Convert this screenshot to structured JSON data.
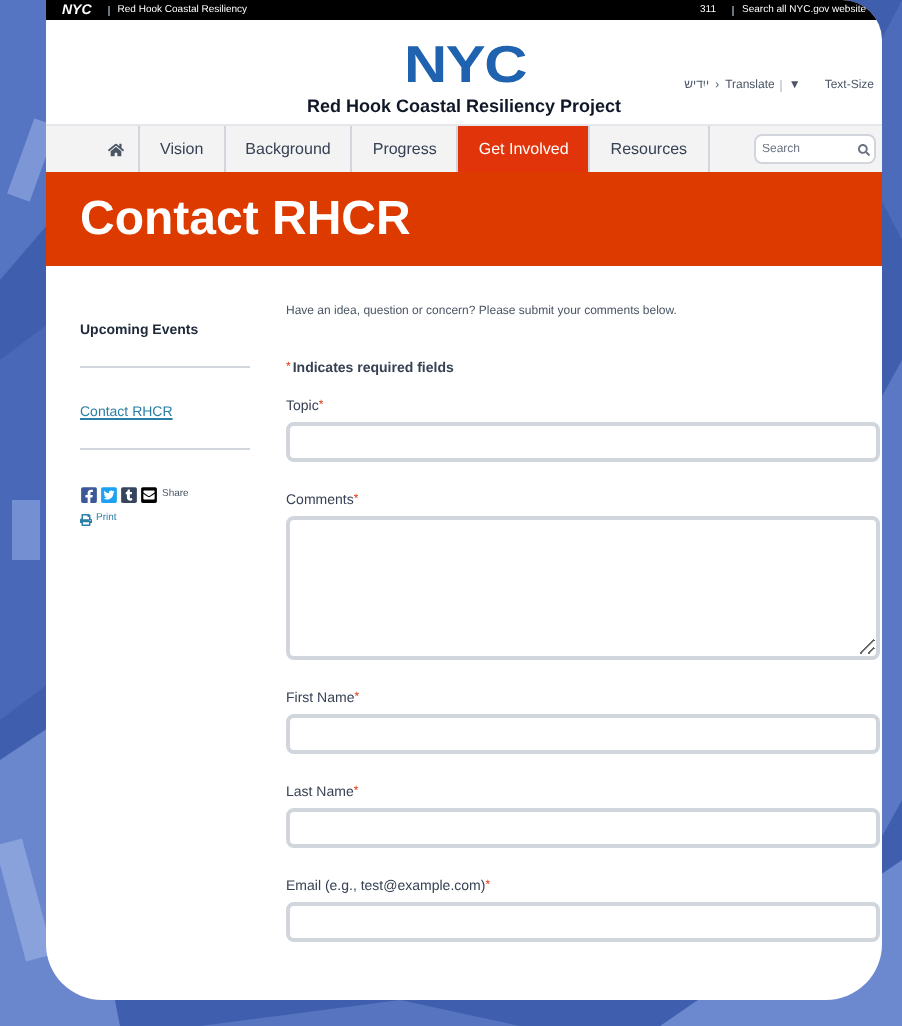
{
  "top_bar": {
    "logo": "NYC",
    "site_name": "Red Hook Coastal Resiliency",
    "phone_link": "311",
    "search_link": "Search all NYC.gov website"
  },
  "header": {
    "logo": "NYC",
    "title": "Red Hook Coastal Resiliency Project",
    "language": "ייִדיש",
    "language_arrow": "›",
    "translate": "Translate",
    "translate_arrow": "▼",
    "text_size": "Text-Size"
  },
  "nav": {
    "items": [
      {
        "label": "Vision",
        "selected": false
      },
      {
        "label": "Background",
        "selected": false
      },
      {
        "label": "Progress",
        "selected": false
      },
      {
        "label": "Get Involved",
        "selected": true
      },
      {
        "label": "Resources",
        "selected": false
      }
    ],
    "search": {
      "placeholder": "Search"
    }
  },
  "banner": {
    "title": "Contact RHCR"
  },
  "sidebar": {
    "items": [
      {
        "label": "Upcoming Events",
        "selected": false
      },
      {
        "label": "Contact RHCR",
        "selected": true
      }
    ],
    "share_label": "Share",
    "print_label": "Print"
  },
  "form": {
    "intro": "Have an idea, question or concern? Please submit your comments below.",
    "required_mark": "*",
    "required_note": "Indicates required fields",
    "fields": [
      {
        "label": "Topic",
        "kind": "input"
      },
      {
        "label": "Comments",
        "kind": "textarea"
      },
      {
        "label": "First Name",
        "kind": "input"
      },
      {
        "label": "Last Name",
        "kind": "input"
      },
      {
        "label": "Email (e.g., test@example.com)",
        "kind": "input"
      }
    ]
  }
}
